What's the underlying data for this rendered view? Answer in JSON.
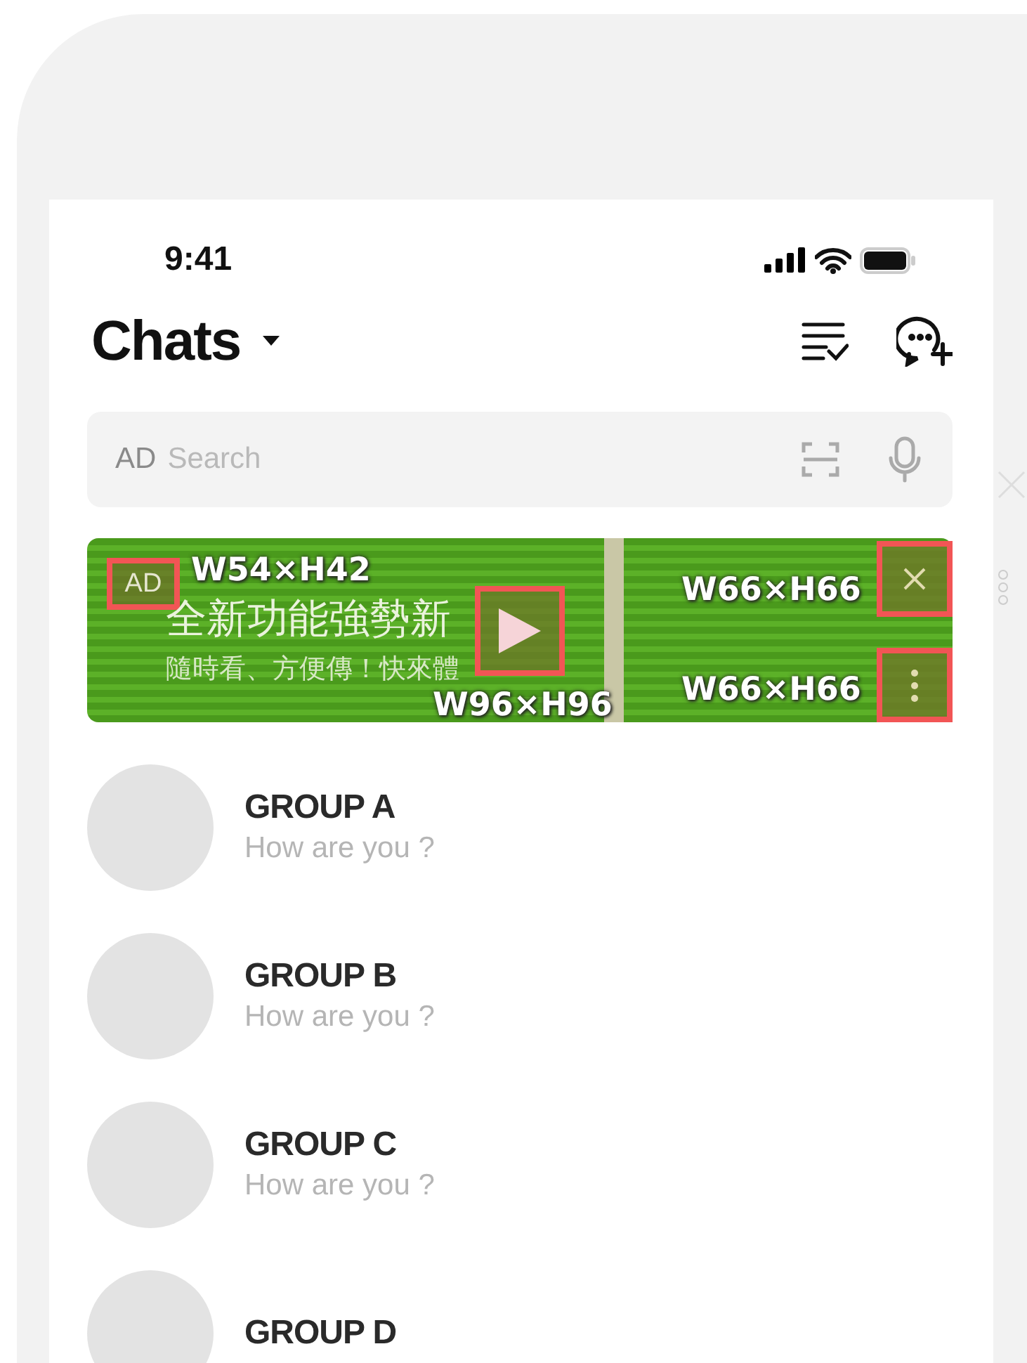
{
  "status_bar": {
    "time": "9:41"
  },
  "header": {
    "title": "Chats"
  },
  "search": {
    "badge": "AD",
    "placeholder": "Search"
  },
  "ad_banner": {
    "badge": "AD",
    "headline": "全新功能強勢新",
    "subline": "隨時看、方便傳！快來體"
  },
  "annotations": [
    {
      "kind": "badge",
      "label": "W54×H42"
    },
    {
      "kind": "play",
      "label": "W96×H96"
    },
    {
      "kind": "close",
      "label": "W66×H66"
    },
    {
      "kind": "more",
      "label": "W66×H66"
    }
  ],
  "chats": [
    {
      "name": "GROUP A",
      "preview": "How are you ?"
    },
    {
      "name": "GROUP B",
      "preview": "How are you ?"
    },
    {
      "name": "GROUP C",
      "preview": "How are you ?"
    },
    {
      "name": "GROUP D"
    }
  ]
}
